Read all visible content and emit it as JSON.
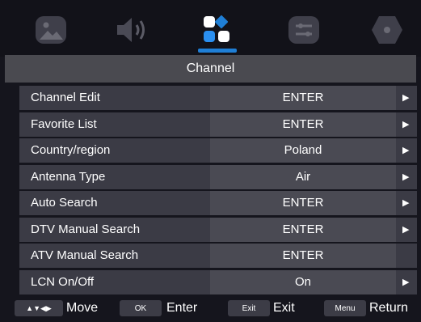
{
  "tabs": [
    {
      "icon": "picture-icon"
    },
    {
      "icon": "sound-icon"
    },
    {
      "icon": "channel-icon",
      "active": true
    },
    {
      "icon": "settings-icon"
    },
    {
      "icon": "lock-icon"
    }
  ],
  "header": {
    "title": "Channel"
  },
  "menu": {
    "items": [
      {
        "label": "Channel Edit",
        "value": "ENTER",
        "arrow": "▶"
      },
      {
        "label": "Favorite List",
        "value": "ENTER",
        "arrow": "▶"
      },
      {
        "label": "Country/region",
        "value": "Poland",
        "arrow": "▶"
      },
      {
        "label": "Antenna Type",
        "value": "Air",
        "arrow": "▶"
      },
      {
        "label": "Auto Search",
        "value": "ENTER",
        "arrow": "▶"
      },
      {
        "label": "DTV Manual Search",
        "value": "ENTER",
        "arrow": "▶"
      },
      {
        "label": "ATV Manual Search",
        "value": "ENTER",
        "arrow": ""
      },
      {
        "label": "LCN On/Off",
        "value": "On",
        "arrow": "▶"
      }
    ]
  },
  "footer": {
    "move_key": "▲▼◀▶",
    "move_label": "Move",
    "ok_key": "OK",
    "enter_label": "Enter",
    "exit_key": "Exit",
    "exit_label": "Exit",
    "menu_key": "Menu",
    "return_label": "Return"
  },
  "colors": {
    "background": "#15151d",
    "header": "#4a4a50",
    "row": "#3b3b45",
    "value_cell": "#4a4a53",
    "accent": "#1f7fd6"
  }
}
